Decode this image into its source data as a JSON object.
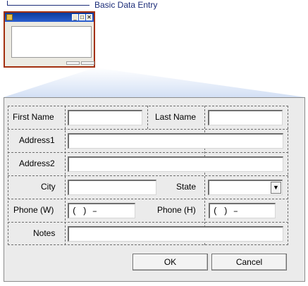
{
  "callout": {
    "label": "Basic Data Entry"
  },
  "thumbnail": {
    "title_icons": {
      "app": "app-icon",
      "minimize": "minimize-icon",
      "maximize": "maximize-icon",
      "close": "close-icon"
    },
    "minimize_glyph": "_",
    "maximize_glyph": "□",
    "close_glyph": "✕"
  },
  "form": {
    "first_name": {
      "label": "First Name",
      "value": ""
    },
    "last_name": {
      "label": "Last Name",
      "value": ""
    },
    "address1": {
      "label": "Address1",
      "value": ""
    },
    "address2": {
      "label": "Address2",
      "value": ""
    },
    "city": {
      "label": "City",
      "value": ""
    },
    "state": {
      "label": "State",
      "value": "",
      "arrow": "▼"
    },
    "phone_work": {
      "label": "Phone (W)",
      "mask": "( )  –"
    },
    "phone_home": {
      "label": "Phone (H)",
      "mask": "( )  –"
    },
    "notes": {
      "label": "Notes",
      "value": ""
    }
  },
  "buttons": {
    "ok": "OK",
    "cancel": "Cancel"
  },
  "colors": {
    "thumb_border": "#a3300f",
    "callout": "#1a2b78",
    "window_bg": "#ebebeb",
    "wedge": "#dbe6f6"
  }
}
